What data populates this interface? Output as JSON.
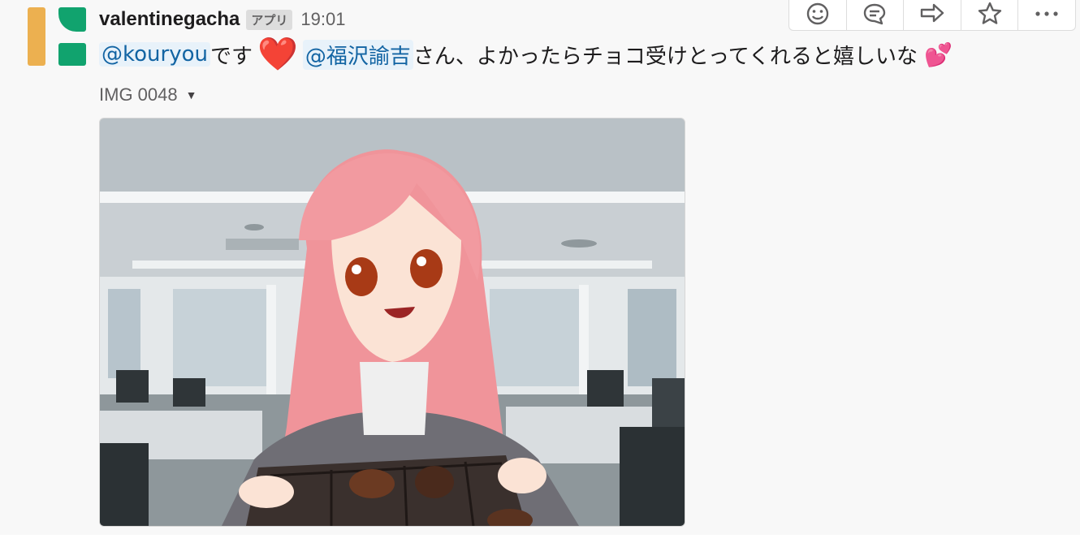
{
  "message": {
    "sender": "valentinegacha",
    "app_badge": "アプリ",
    "time": "19:01",
    "mention_1": "@kouryou",
    "text_1": "です",
    "heart_emoji": "❤️",
    "mention_2": "@福沢諭吉",
    "text_2": "さん、よかったらチョコ受けとってくれると嬉しいな",
    "hearts_emoji": "💕"
  },
  "attachment": {
    "file_name": "IMG 0048"
  },
  "toolbar": {
    "icons": [
      "add-reaction-icon",
      "reply-thread-icon",
      "share-icon",
      "star-icon",
      "more-actions-icon"
    ]
  },
  "colors": {
    "mention": "#1264a3",
    "mention_bg": "#e8f2fa",
    "avatar_orange": "#ecb050",
    "avatar_green": "#11a36e",
    "hair": "#f0949a"
  }
}
